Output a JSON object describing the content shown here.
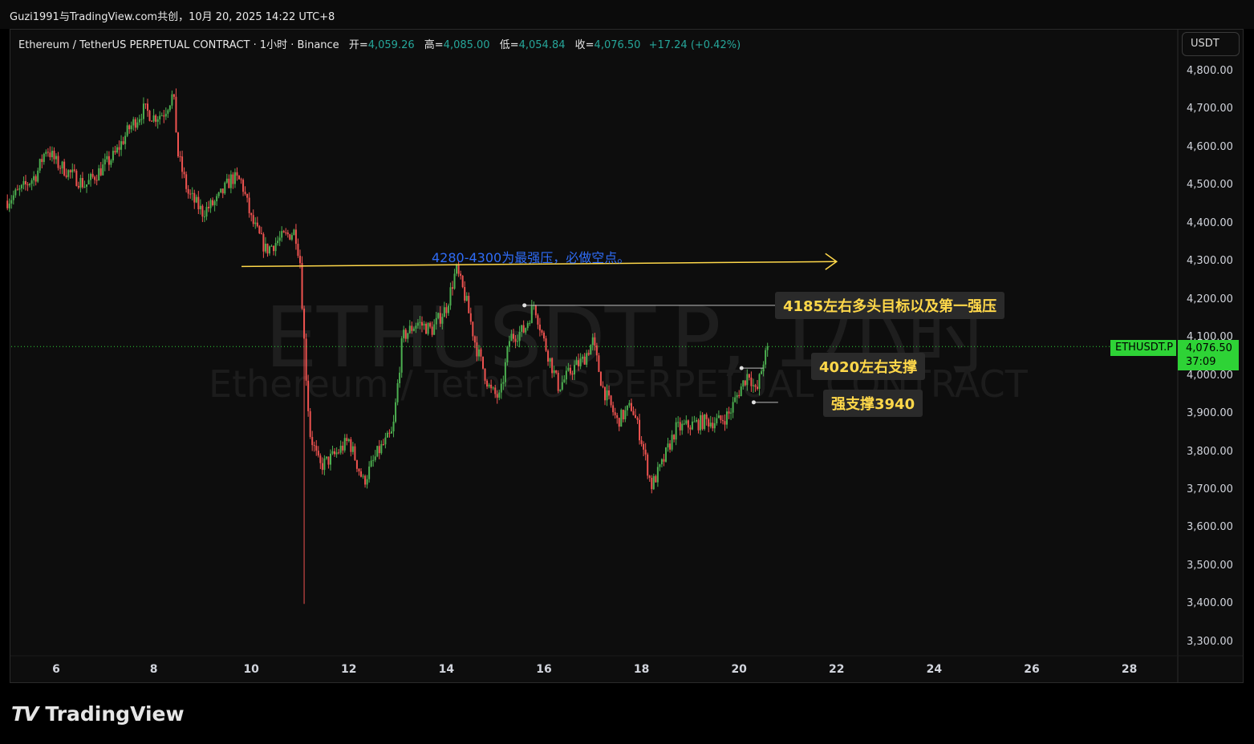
{
  "header": {
    "share_text": "Guzi1991与TradingView.com共创，10月 20, 2025 14:22 UTC+8"
  },
  "legend": {
    "title": "Ethereum / TetherUS PERPETUAL CONTRACT · 1小时 · Binance",
    "open_label": "开=",
    "open": "4,059.26",
    "high_label": "高=",
    "high": "4,085.00",
    "low_label": "低=",
    "low": "4,054.84",
    "close_label": "收=",
    "close": "4,076.50",
    "change": "+17.24 (+0.42%)"
  },
  "currency_button": "USDT",
  "watermark": {
    "symbol": "ETHUSDT.P, 1小时",
    "name": "Ethereum / TetherUS PERPETUAL CONTRACT"
  },
  "annotations": {
    "resistance_note": "4280-4300为最强压，必做空点。",
    "target_tag": "4185左右多头目标以及第一强压",
    "support_tag": "4020左右支撑",
    "strong_support_tag": "强支撑3940"
  },
  "price_scale": {
    "symbol": "ETHUSDT.P",
    "last_price": "4,076.50",
    "countdown": "37:09"
  },
  "brand": {
    "name": "TradingView",
    "logo": "TV"
  },
  "colors": {
    "up": "#26a69a",
    "up_bright": "#4caf50",
    "down": "#ef5350",
    "accent_yellow": "#ffd84a",
    "note_blue": "#2f6cf6",
    "last_price": "#2ed336"
  },
  "chart_data": {
    "type": "candlestick",
    "title": "Ethereum / TetherUS PERPETUAL CONTRACT · 1小时 · Binance",
    "y_ticks": [
      "4,800.00",
      "4,700.00",
      "4,600.00",
      "4,500.00",
      "4,400.00",
      "4,300.00",
      "4,200.00",
      "4,100.00",
      "4,000.00",
      "3,900.00",
      "3,800.00",
      "3,700.00",
      "3,600.00",
      "3,500.00",
      "3,400.00",
      "3,300.00"
    ],
    "x_ticks": [
      "6",
      "8",
      "10",
      "12",
      "14",
      "16",
      "18",
      "20",
      "22",
      "24",
      "26",
      "28"
    ],
    "ylim": [
      3260,
      4860
    ],
    "xlim": [
      5.0,
      29.6
    ],
    "last_x": 20.62,
    "price_path": [
      [
        5.0,
        4460
      ],
      [
        5.3,
        4490
      ],
      [
        5.6,
        4530
      ],
      [
        5.8,
        4600
      ],
      [
        6.0,
        4560
      ],
      [
        6.3,
        4530
      ],
      [
        6.6,
        4500
      ],
      [
        6.9,
        4540
      ],
      [
        7.2,
        4580
      ],
      [
        7.5,
        4650
      ],
      [
        7.8,
        4700
      ],
      [
        8.0,
        4680
      ],
      [
        8.2,
        4690
      ],
      [
        8.4,
        4740
      ],
      [
        8.5,
        4580
      ],
      [
        8.7,
        4480
      ],
      [
        9.0,
        4430
      ],
      [
        9.3,
        4460
      ],
      [
        9.6,
        4520
      ],
      [
        9.8,
        4510
      ],
      [
        10.0,
        4410
      ],
      [
        10.3,
        4330
      ],
      [
        10.6,
        4360
      ],
      [
        10.9,
        4380
      ],
      [
        11.0,
        4300
      ],
      [
        11.1,
        4050
      ],
      [
        11.2,
        3850
      ],
      [
        11.4,
        3760
      ],
      [
        11.7,
        3790
      ],
      [
        12.0,
        3830
      ],
      [
        12.3,
        3720
      ],
      [
        12.6,
        3800
      ],
      [
        12.9,
        3850
      ],
      [
        13.1,
        4100
      ],
      [
        13.4,
        4140
      ],
      [
        13.7,
        4120
      ],
      [
        14.0,
        4180
      ],
      [
        14.2,
        4280
      ],
      [
        14.4,
        4200
      ],
      [
        14.6,
        4080
      ],
      [
        14.9,
        3960
      ],
      [
        15.1,
        3940
      ],
      [
        15.3,
        4100
      ],
      [
        15.6,
        4120
      ],
      [
        15.8,
        4190
      ],
      [
        16.0,
        4090
      ],
      [
        16.3,
        3970
      ],
      [
        16.6,
        4020
      ],
      [
        16.8,
        4040
      ],
      [
        17.0,
        4090
      ],
      [
        17.2,
        3970
      ],
      [
        17.5,
        3880
      ],
      [
        17.8,
        3920
      ],
      [
        18.0,
        3830
      ],
      [
        18.2,
        3710
      ],
      [
        18.4,
        3760
      ],
      [
        18.7,
        3860
      ],
      [
        19.0,
        3870
      ],
      [
        19.3,
        3880
      ],
      [
        19.6,
        3880
      ],
      [
        19.8,
        3900
      ],
      [
        20.0,
        3960
      ],
      [
        20.2,
        4010
      ],
      [
        20.35,
        3950
      ],
      [
        20.5,
        4040
      ],
      [
        20.62,
        4076.5
      ]
    ],
    "wick_extremes": {
      "low": {
        "x": 11.1,
        "y": 3400
      },
      "high": {
        "x": 8.45,
        "y": 4755
      }
    },
    "drawings": [
      {
        "type": "arrow",
        "from": [
          9.8,
          4287
        ],
        "to": [
          22.0,
          4300
        ],
        "color": "#ffd84a",
        "label": "4280-4300为最强压，必做空点。"
      },
      {
        "type": "hline",
        "x": [
          15.6,
          20.8
        ],
        "y": 4185,
        "label": "4185左右多头目标以及第一强压"
      },
      {
        "type": "hline",
        "x": [
          20.05,
          20.5
        ],
        "y": 4020,
        "label": "4020左右支撑"
      },
      {
        "type": "hline",
        "x": [
          20.3,
          20.8
        ],
        "y": 3930,
        "label": "强支撑3940"
      }
    ],
    "last_price": 4076.5
  }
}
